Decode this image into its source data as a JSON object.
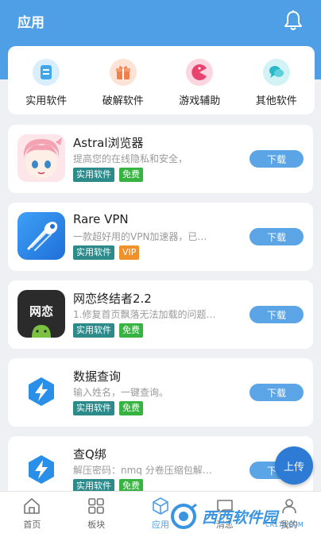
{
  "header": {
    "title": "应用"
  },
  "categories": [
    {
      "label": "实用软件",
      "icon": "document-icon",
      "color": "#3fa7ea",
      "bg": "#d9eefc"
    },
    {
      "label": "破解软件",
      "icon": "gift-icon",
      "color": "#f07f4c",
      "bg": "#fde3d6"
    },
    {
      "label": "游戏辅助",
      "icon": "pacman-icon",
      "color": "#e8436e",
      "bg": "#fbd5df"
    },
    {
      "label": "其他软件",
      "icon": "chat-icon",
      "color": "#28b9c7",
      "bg": "#d3f2f5"
    }
  ],
  "apps": [
    {
      "name": "Astral浏览器",
      "desc": "提高您的在线隐私和安全，",
      "tags": [
        "实用软件",
        "免费"
      ],
      "button": "下载"
    },
    {
      "name": "Rare VPN",
      "desc": "一款超好用的VPN加速器，已…",
      "tags": [
        "实用软件",
        "VIP"
      ],
      "button": "下载"
    },
    {
      "name": "网恋终结者2.2",
      "desc": "1.修复首页飘落无法加载的问题…",
      "tags": [
        "实用软件",
        "免费"
      ],
      "button": "下载",
      "icon_text": "网恋"
    },
    {
      "name": "数据查询",
      "desc": "输入姓名，一键查询。",
      "tags": [
        "实用软件",
        "免费"
      ],
      "button": "下载"
    },
    {
      "name": "查Q绑",
      "desc": "解压密码：nmq 分卷压缩包解…",
      "tags": [
        "实用软件",
        "免费"
      ],
      "button": "下载"
    }
  ],
  "upload_label": "上传",
  "nav": [
    {
      "label": "首页",
      "icon": "home-icon"
    },
    {
      "label": "板块",
      "icon": "grid-icon"
    },
    {
      "label": "应用",
      "icon": "cube-icon",
      "active": true
    },
    {
      "label": "消息",
      "icon": "message-icon"
    },
    {
      "label": "我的",
      "icon": "user-icon"
    }
  ],
  "watermark": {
    "text": "西西软件园",
    "sub": "CR173.COM"
  }
}
